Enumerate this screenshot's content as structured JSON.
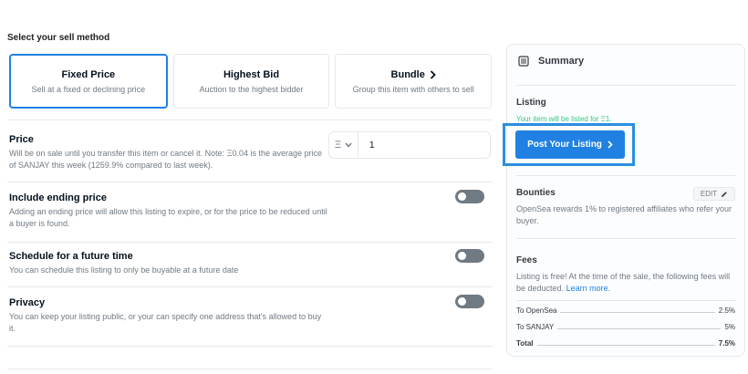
{
  "heading": "Select your sell method",
  "methods": [
    {
      "title": "Fixed Price",
      "subtitle": "Sell at a fixed or declining price"
    },
    {
      "title": "Highest Bid",
      "subtitle": "Auction to the highest bidder"
    },
    {
      "title": "Bundle",
      "subtitle": "Group this item with others to sell"
    }
  ],
  "price": {
    "title": "Price",
    "description": "Will be on sale until you transfer this item or cancel it. Note: Ξ0.04 is the average price of SANJAY this week (1259.9% compared to last week).",
    "currency_symbol": "Ξ",
    "value": "1"
  },
  "ending_price": {
    "title": "Include ending price",
    "description": "Adding an ending price will allow this listing to expire, or for the price to be reduced until a buyer is found."
  },
  "schedule": {
    "title": "Schedule for a future time",
    "description": "You can schedule this listing to only be buyable at a future date"
  },
  "privacy": {
    "title": "Privacy",
    "description": "You can keep your listing public, or your can specify one address that's allowed to buy it."
  },
  "summary": {
    "title": "Summary",
    "listing_title": "Listing",
    "listing_note": "Your item will be listed for Ξ1.",
    "post_button": "Post Your Listing",
    "bounties_title": "Bounties",
    "edit_label": "EDIT",
    "bounties_text": "OpenSea rewards 1% to registered affiliates who refer your buyer.",
    "fees_title": "Fees",
    "fees_text": "Listing is free! At the time of the sale, the following fees will be deducted.",
    "learn_more": "Learn more.",
    "fees": [
      {
        "label": "To OpenSea",
        "value": "2.5%"
      },
      {
        "label": "To SANJAY",
        "value": "5%"
      },
      {
        "label": "Total",
        "value": "7.5%"
      }
    ]
  },
  "colors": {
    "accent": "#2081e2",
    "success": "#34c77b",
    "muted": "#707a83",
    "highlight_box": "#2c8ee0"
  },
  "icons": [
    "chevron-right-icon",
    "ethereum-icon",
    "chevron-down-icon",
    "summary-list-icon",
    "pencil-icon"
  ]
}
